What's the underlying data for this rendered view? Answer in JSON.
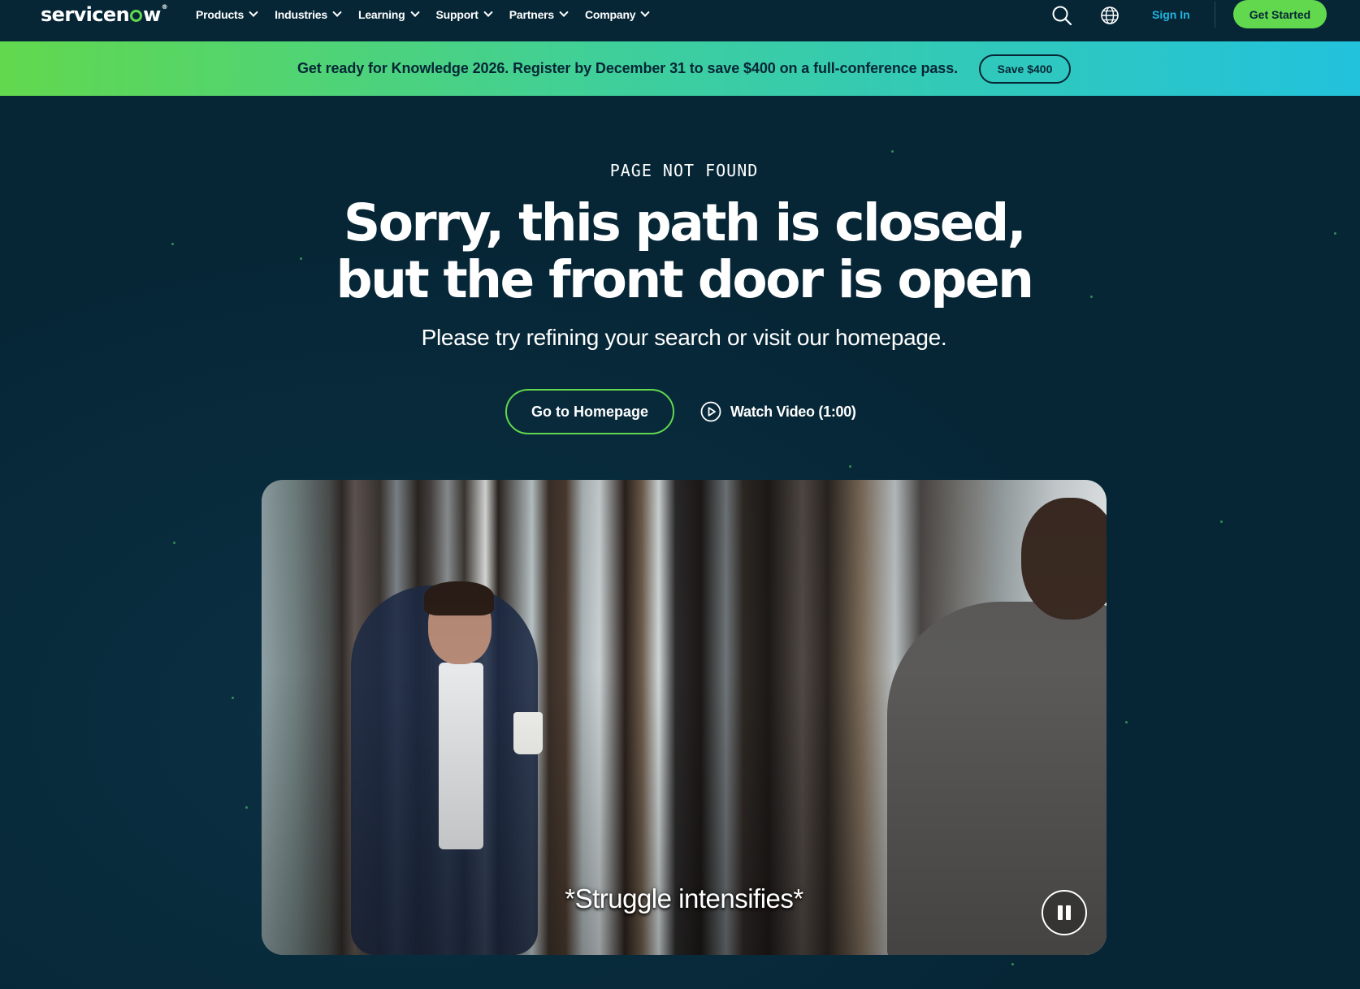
{
  "header": {
    "logo_text_start": "servicen",
    "logo_text_end": "w",
    "logo_mark": "®",
    "nav_items": [
      {
        "label": "Products"
      },
      {
        "label": "Industries"
      },
      {
        "label": "Learning"
      },
      {
        "label": "Support"
      },
      {
        "label": "Partners"
      },
      {
        "label": "Company"
      }
    ],
    "icons": {
      "search": "search-icon",
      "language": "globe-icon"
    },
    "sign_in_label": "Sign In",
    "get_started_label": "Get Started",
    "colors": {
      "background": "#062636",
      "accent": "#62d84e",
      "sign_in": "#21b5e1"
    }
  },
  "banner": {
    "text": "Get ready for Knowledge 2026. Register by December 31 to save $400 on a full-conference pass.",
    "button_label": "Save $400",
    "gradient": [
      "#62d84e",
      "#22c2dc"
    ]
  },
  "hero": {
    "eyebrow": "PAGE NOT FOUND",
    "headline_line1": "Sorry, this path is closed,",
    "headline_line2": "but the front door is open",
    "subline": "Please try refining your search or visit our homepage.",
    "primary_button": "Go to Homepage",
    "secondary_button": "Watch Video (1:00)",
    "secondary_icon": "play-circle-icon"
  },
  "video": {
    "caption": "*Struggle intensifies*",
    "control_icon": "pause-icon",
    "state": "playing"
  }
}
